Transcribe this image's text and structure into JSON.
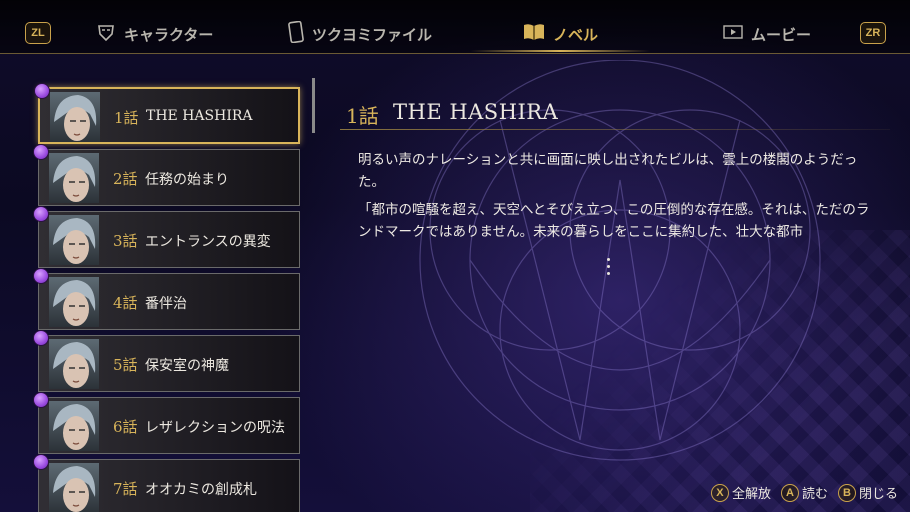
{
  "nav": {
    "left_shoulder": "ZL",
    "right_shoulder": "ZR",
    "tabs": [
      {
        "label": "キャラクター",
        "icon": "mask-icon",
        "active": false
      },
      {
        "label": "ツクヨミファイル",
        "icon": "phone-icon",
        "active": false
      },
      {
        "label": "ノベル",
        "icon": "book-icon",
        "active": true
      },
      {
        "label": "ムービー",
        "icon": "play-icon",
        "active": false
      }
    ]
  },
  "episodes": [
    {
      "num": "1話",
      "title": "THE HASHIRA",
      "selected": true
    },
    {
      "num": "2話",
      "title": "任務の始まり",
      "selected": false
    },
    {
      "num": "3話",
      "title": "エントランスの異変",
      "selected": false
    },
    {
      "num": "4話",
      "title": "番伴治",
      "selected": false
    },
    {
      "num": "5話",
      "title": "保安室の神魔",
      "selected": false
    },
    {
      "num": "6話",
      "title": "レザレクションの呪法",
      "selected": false
    },
    {
      "num": "7話",
      "title": "オオカミの創成札",
      "selected": false
    }
  ],
  "detail": {
    "num": "1話",
    "title": "THE HASHIRA",
    "paragraphs": [
      "明るい声のナレーションと共に画面に映し出されたビルは、雲上の楼閣のようだった。",
      "「都市の喧騒を超え、天空へとそびえ立つ、この圧倒的な存在感。それは、ただのランドマークではありません。未来の暮らしをここに集約した、壮大な都市"
    ]
  },
  "hints": [
    {
      "button": "X",
      "label": "全解放"
    },
    {
      "button": "A",
      "label": "読む"
    },
    {
      "button": "B",
      "label": "閉じる"
    }
  ],
  "colors": {
    "accent": "#d8b45a",
    "selected_dot": "#9a4be0"
  }
}
